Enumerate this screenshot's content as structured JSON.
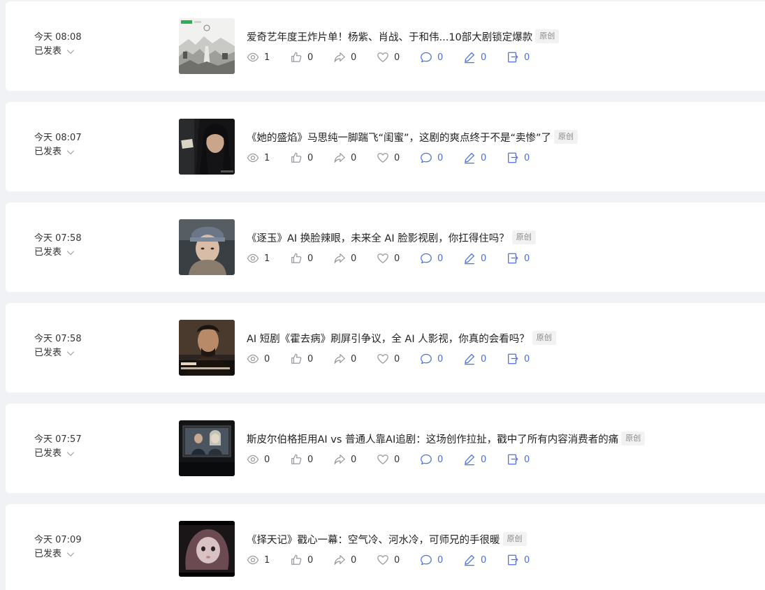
{
  "colors": {
    "accent_blue": "#4a6ee0",
    "icon_gray": "#9a9aa0",
    "page_bg": "#f0f2f5",
    "card_bg": "#ffffff",
    "badge_bg": "#f2f2f2"
  },
  "articles": [
    {
      "time": "今天 08:08",
      "status": "已发表",
      "title": "爱奇艺年度王炸片单！杨紫、肖战、于和伟...10部大剧锁定爆款",
      "badge": "原创",
      "views": "1",
      "likes": "0",
      "shares": "0",
      "favorites": "0",
      "comments": "0",
      "edits": "0",
      "forwards": "0"
    },
    {
      "time": "今天 08:07",
      "status": "已发表",
      "title": "《她的盛焰》马思纯一脚踹飞“闺蜜”，这剧的爽点终于不是“卖惨”了",
      "badge": "原创",
      "views": "1",
      "likes": "0",
      "shares": "0",
      "favorites": "0",
      "comments": "0",
      "edits": "0",
      "forwards": "0"
    },
    {
      "time": "今天 07:58",
      "status": "已发表",
      "title": "《逐玉》AI 换脸辣眼，未来全 AI 脸影视剧，你扛得住吗？",
      "badge": "原创",
      "views": "1",
      "likes": "0",
      "shares": "0",
      "favorites": "0",
      "comments": "0",
      "edits": "0",
      "forwards": "0"
    },
    {
      "time": "今天 07:58",
      "status": "已发表",
      "title": "AI 短剧《霍去病》刷屏引争议，全 AI 人影视，你真的会看吗？",
      "badge": "原创",
      "views": "0",
      "likes": "0",
      "shares": "0",
      "favorites": "0",
      "comments": "0",
      "edits": "0",
      "forwards": "0"
    },
    {
      "time": "今天 07:57",
      "status": "已发表",
      "title": "斯皮尔伯格拒用AI vs 普通人靠AI追剧：这场创作拉扯，戳中了所有内容消费者的痛",
      "badge": "原创",
      "views": "0",
      "likes": "0",
      "shares": "0",
      "favorites": "0",
      "comments": "0",
      "edits": "0",
      "forwards": "0"
    },
    {
      "time": "今天 07:09",
      "status": "已发表",
      "title": "《择天记》戳心一幕：空气冷、河水冷，可师兄的手很暖",
      "badge": "原创",
      "views": "1",
      "likes": "0",
      "shares": "0",
      "favorites": "0",
      "comments": "0",
      "edits": "0",
      "forwards": "0"
    }
  ]
}
